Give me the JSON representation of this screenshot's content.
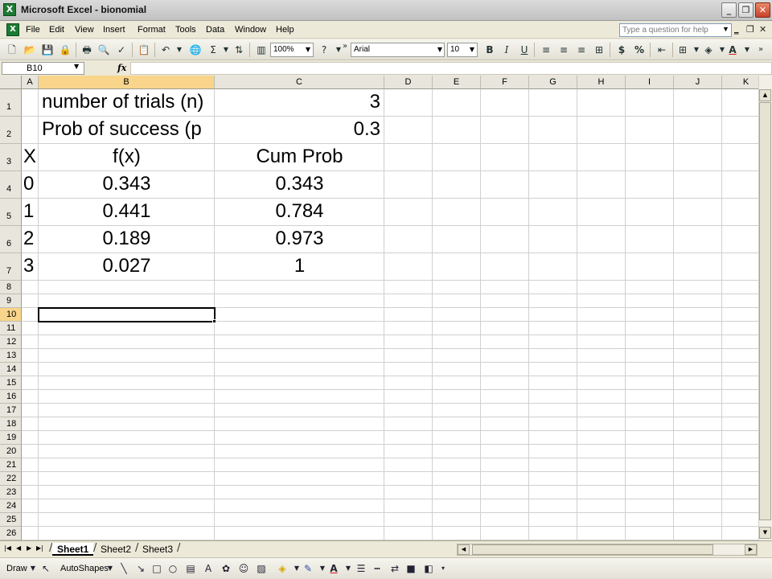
{
  "window": {
    "title": "Microsoft Excel - bionomial",
    "app_icon": "excel-icon"
  },
  "menu": {
    "items": [
      "File",
      "Edit",
      "View",
      "Insert",
      "Format",
      "Tools",
      "Data",
      "Window",
      "Help"
    ],
    "help_placeholder": "Type a question for help"
  },
  "toolbar": {
    "zoom": "100%",
    "font": "Arial",
    "font_size": "10"
  },
  "formula_bar": {
    "name_box": "B10",
    "fx_label": "fx",
    "formula": ""
  },
  "grid": {
    "columns": [
      "A",
      "B",
      "C",
      "D",
      "E",
      "F",
      "G",
      "H",
      "I",
      "J",
      "K"
    ],
    "rows": [
      "1",
      "2",
      "3",
      "4",
      "5",
      "6",
      "7",
      "8",
      "9",
      "10",
      "11",
      "12",
      "13",
      "14",
      "15",
      "16",
      "17",
      "18",
      "19",
      "20",
      "21",
      "22",
      "23",
      "24",
      "25",
      "26"
    ],
    "selected_cell": "B10",
    "cells": {
      "B1": "number of trials (n)",
      "C1": "3",
      "B2": "Prob of success (p",
      "C2": "0.3",
      "A3": "X",
      "B3": "f(x)",
      "C3": "Cum Prob",
      "A4": "0",
      "B4": "0.343",
      "C4": "0.343",
      "A5": "1",
      "B5": "0.441",
      "C5": "0.784",
      "A6": "2",
      "B6": "0.189",
      "C6": "0.973",
      "A7": "3",
      "B7": "0.027",
      "C7": "1"
    }
  },
  "sheet_tabs": [
    "Sheet1",
    "Sheet2",
    "Sheet3"
  ],
  "active_sheet": "Sheet1",
  "draw_toolbar": {
    "draw_label": "Draw",
    "autoshapes_label": "AutoShapes"
  },
  "colors": {
    "selection_header": "#f8d58b",
    "font_color_bar": "#d81a1a",
    "fill_color_bar": "#f6e300"
  }
}
